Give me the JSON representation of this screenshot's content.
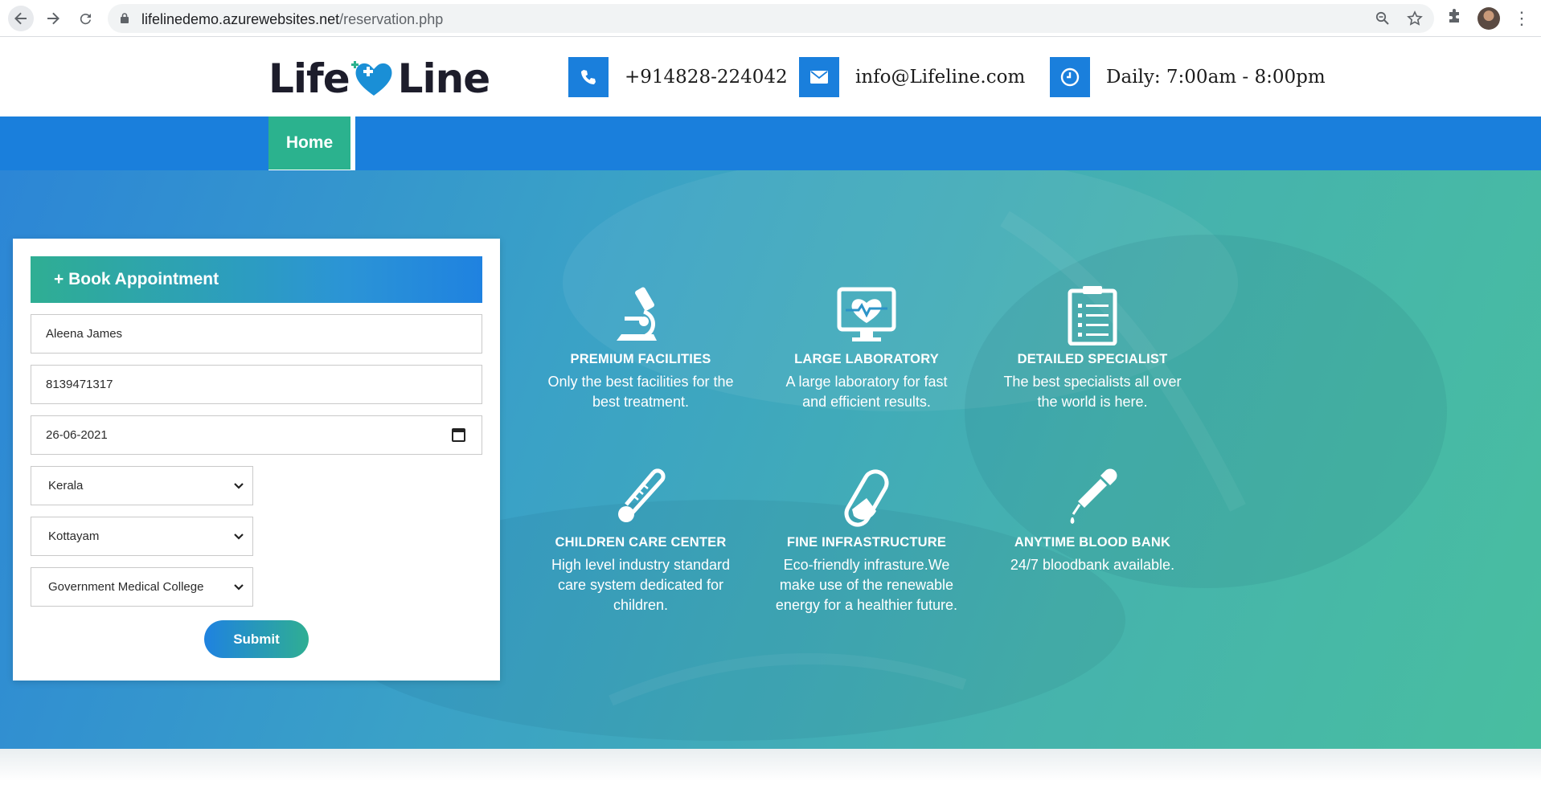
{
  "browser": {
    "url_host": "lifelinedemo.azurewebsites.net",
    "url_path": "/reservation.php",
    "back_icon": "arrow-left-icon",
    "forward_icon": "arrow-right-icon",
    "reload_icon": "reload-icon"
  },
  "header": {
    "logo_left": "Life",
    "logo_right": "Line",
    "phone": "+914828-224042",
    "email": "info@Lifeline.com",
    "hours": "Daily: 7:00am - 8:00pm"
  },
  "nav": {
    "home_label": "Home"
  },
  "form": {
    "title": "+ Book Appointment",
    "name_value": "Aleena James",
    "phone_value": "8139471317",
    "date_value": "26-06-2021",
    "state_value": "Kerala",
    "district_value": "Kottayam",
    "hospital_value": "Government Medical College",
    "submit_label": "Submit"
  },
  "features": [
    {
      "icon": "microscope-icon",
      "title": "PREMIUM FACILITIES",
      "desc_line1": "Only the best facilities for the",
      "desc_line2": "best treatment.",
      "desc_line3": ""
    },
    {
      "icon": "heart-monitor-icon",
      "title": "LARGE LABORATORY",
      "desc_line1": "A large laboratory for fast",
      "desc_line2": "and efficient results.",
      "desc_line3": ""
    },
    {
      "icon": "clipboard-icon",
      "title": "DETAILED SPECIALIST",
      "desc_line1": "The best specialists all over",
      "desc_line2": "the world is here.",
      "desc_line3": ""
    },
    {
      "icon": "thermometer-icon",
      "title": "CHILDREN CARE CENTER",
      "desc_line1": "High level industry standard",
      "desc_line2": "care system dedicated for",
      "desc_line3": "children."
    },
    {
      "icon": "pill-icon",
      "title": "FINE INFRASTRUCTURE",
      "desc_line1": "Eco-friendly infrasture.We",
      "desc_line2": "make use of the renewable",
      "desc_line3": "energy for a healthier future."
    },
    {
      "icon": "dropper-icon",
      "title": "ANYTIME BLOOD BANK",
      "desc_line1": "24/7 bloodbank available.",
      "desc_line2": "",
      "desc_line3": ""
    }
  ],
  "colors": {
    "brand_blue": "#1a7fdc",
    "brand_green": "#2bb28e"
  }
}
